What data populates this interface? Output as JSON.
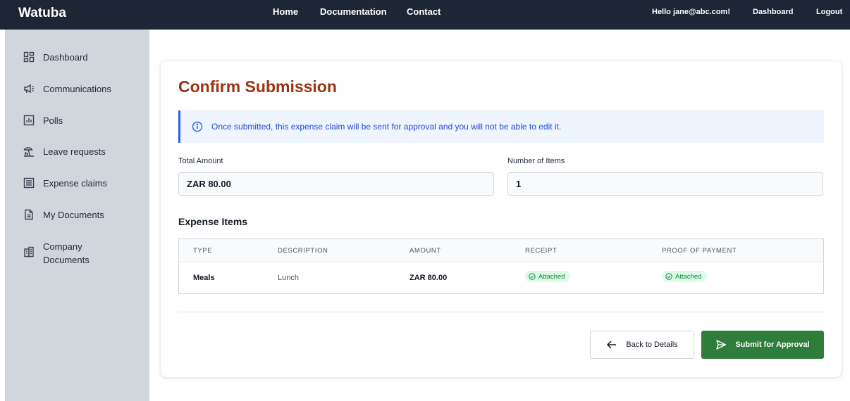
{
  "app": {
    "brand": "Watuba",
    "nav": [
      "Home",
      "Documentation",
      "Contact"
    ],
    "greeting": "Hello jane@abc.com!",
    "dashboard_link": "Dashboard",
    "logout_link": "Logout"
  },
  "sidebar": {
    "items": [
      {
        "label": "Dashboard",
        "icon": "dashboard-icon"
      },
      {
        "label": "Communications",
        "icon": "megaphone-icon"
      },
      {
        "label": "Polls",
        "icon": "bar-chart-icon"
      },
      {
        "label": "Leave requests",
        "icon": "beach-icon"
      },
      {
        "label": "Expense claims",
        "icon": "list-icon"
      },
      {
        "label": "My Documents",
        "icon": "document-icon"
      },
      {
        "label": "Company Documents",
        "icon": "building-icon"
      }
    ]
  },
  "main": {
    "title": "Confirm Submission",
    "alert": "Once submitted, this expense claim will be sent for approval and you will not be able to edit it.",
    "total_amount_label": "Total Amount",
    "total_amount_value": "ZAR 80.00",
    "item_count_label": "Number of Items",
    "item_count_value": "1",
    "section_title": "Expense Items",
    "table": {
      "headers": [
        "TYPE",
        "DESCRIPTION",
        "AMOUNT",
        "RECEIPT",
        "PROOF OF PAYMENT"
      ],
      "rows": [
        {
          "type": "Meals",
          "description": "Lunch",
          "amount": "ZAR 80.00",
          "receipt": "Attached",
          "proof": "Attached"
        }
      ]
    },
    "back_button": "Back to Details",
    "submit_button": "Submit for Approval"
  },
  "colors": {
    "topbar": "#1e2635",
    "sidebar": "#d1d5dc",
    "title": "#9a3412",
    "alert_bg": "#eef5ff",
    "alert_text": "#1d4ed8",
    "submit": "#2e7d3a",
    "badge_bg": "#dcfce7",
    "badge_text": "#15803d"
  }
}
